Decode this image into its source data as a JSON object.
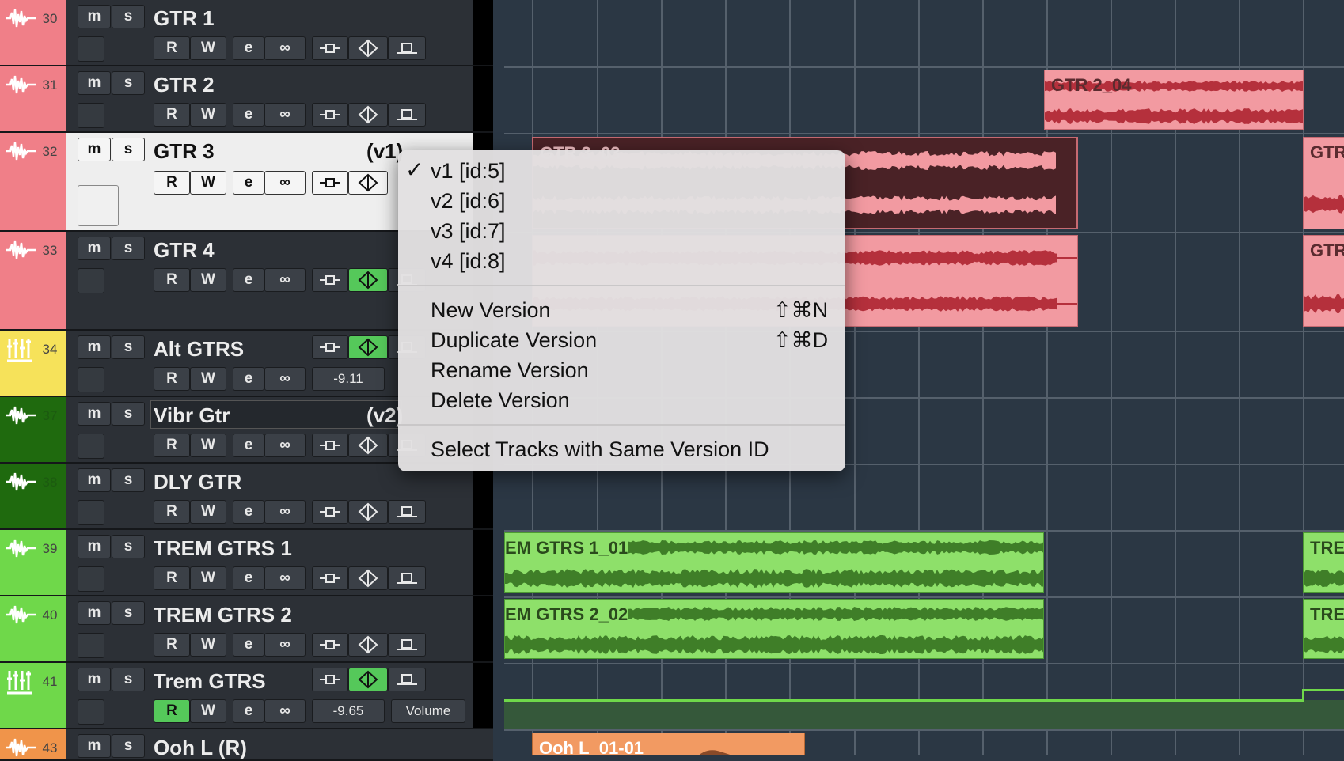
{
  "tracks": [
    {
      "num": "30",
      "name": "GTR 1",
      "version": "",
      "color": "#f07f88",
      "type": "audio",
      "automation": "",
      "volume": ""
    },
    {
      "num": "31",
      "name": "GTR 2",
      "version": "",
      "color": "#f07f88",
      "type": "audio",
      "automation": "",
      "volume": ""
    },
    {
      "num": "32",
      "name": "GTR 3",
      "version": "(v1)",
      "color": "#f07f88",
      "type": "audio",
      "automation": "",
      "volume": ""
    },
    {
      "num": "33",
      "name": "GTR 4",
      "version": "",
      "color": "#f07f88",
      "type": "audio",
      "automation": "",
      "volume": ""
    },
    {
      "num": "34",
      "name": "Alt GTRS",
      "version": "",
      "color": "#f6e25a",
      "type": "folder",
      "automation": "",
      "volume": "-9.11"
    },
    {
      "num": "37",
      "name": "Vibr Gtr",
      "version": "(v2)",
      "color": "#1f6a0e",
      "type": "audio",
      "automation": "",
      "volume": ""
    },
    {
      "num": "38",
      "name": "DLY GTR",
      "version": "",
      "color": "#1f6a0e",
      "type": "audio",
      "automation": "",
      "volume": ""
    },
    {
      "num": "39",
      "name": "TREM GTRS 1",
      "version": "",
      "color": "#6fd84a",
      "type": "audio",
      "automation": "",
      "volume": ""
    },
    {
      "num": "40",
      "name": "TREM GTRS 2",
      "version": "",
      "color": "#6fd84a",
      "type": "audio",
      "automation": "",
      "volume": ""
    },
    {
      "num": "41",
      "name": "Trem GTRS",
      "version": "",
      "color": "#6fd84a",
      "type": "folder",
      "automation": "Volume",
      "volume": "-9.65"
    },
    {
      "num": "43",
      "name": "Ooh L (R)",
      "version": "",
      "color": "#f0944a",
      "type": "audio",
      "automation": "",
      "volume": ""
    }
  ],
  "buttons": {
    "mute": "m",
    "solo": "s",
    "read": "R",
    "write": "W",
    "edit": "e",
    "link": "∞"
  },
  "clips": {
    "gtr2_04": "GTR 2_04",
    "gtr3": "GTR 3_03",
    "gtr_right_1": "GTR",
    "gtr_right_2": "GTR",
    "trem1": "EM GTRS 1_01",
    "trem2": "EM GTRS 2_02",
    "trem_right_1": "TRE",
    "trem_right_2": "TRE",
    "ooh": "Ooh L_01-01"
  },
  "menu": {
    "versions": [
      {
        "label": "v1 [id:5]",
        "checked": true
      },
      {
        "label": "v2 [id:6]",
        "checked": false
      },
      {
        "label": "v3 [id:7]",
        "checked": false
      },
      {
        "label": "v4 [id:8]",
        "checked": false
      }
    ],
    "check": "✓",
    "actions": [
      {
        "label": "New Version",
        "shortcut": "⇧⌘N"
      },
      {
        "label": "Duplicate Version",
        "shortcut": "⇧⌘D"
      },
      {
        "label": "Rename Version",
        "shortcut": ""
      },
      {
        "label": "Delete Version",
        "shortcut": ""
      }
    ],
    "select_same": "Select Tracks with Same Version ID"
  },
  "colors": {
    "red": "#f07f88",
    "yellow": "#f6e25a",
    "dark_green": "#1f6a0e",
    "green": "#6fd84a",
    "orange": "#f0944a",
    "on": "#55c85a"
  }
}
